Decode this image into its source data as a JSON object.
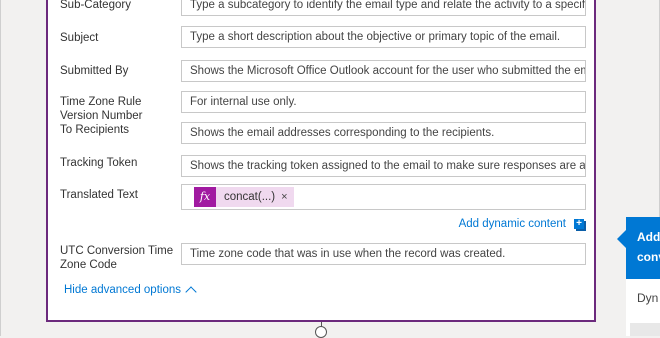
{
  "fields": [
    {
      "label": "Sub-Category",
      "placeholder": "Type a subcategory to identify the email type and relate the activity to a specific"
    },
    {
      "label": "Subject",
      "placeholder": "Type a short description about the objective or primary topic of the email."
    },
    {
      "label": "Submitted By",
      "placeholder": "Shows the Microsoft Office Outlook account for the user who submitted the em"
    },
    {
      "label": "Time Zone Rule Version Number",
      "placeholder": "For internal use only."
    },
    {
      "label": "To Recipients",
      "placeholder": "Shows the email addresses corresponding to the recipients."
    },
    {
      "label": "Tracking Token",
      "placeholder": "Shows the tracking token assigned to the email to make sure responses are au"
    },
    {
      "label": "Translated Text",
      "token": {
        "icon": "fx",
        "text": "concat(...)",
        "remove": "×"
      }
    },
    {
      "label": "UTC Conversion Time Zone Code",
      "placeholder": "Time zone code that was in use when the record was created."
    }
  ],
  "add_dynamic_content": "Add dynamic content",
  "add_dynamic_plus": "+",
  "hide_advanced": "Hide advanced options",
  "popup": {
    "line1": "Add",
    "line2": "conv",
    "lower": "Dyn"
  },
  "colors": {
    "card_border": "#6c2a7d",
    "link": "#0078d4",
    "token_icon_bg": "#a11aa1",
    "token_bg": "#f0d9ef"
  }
}
